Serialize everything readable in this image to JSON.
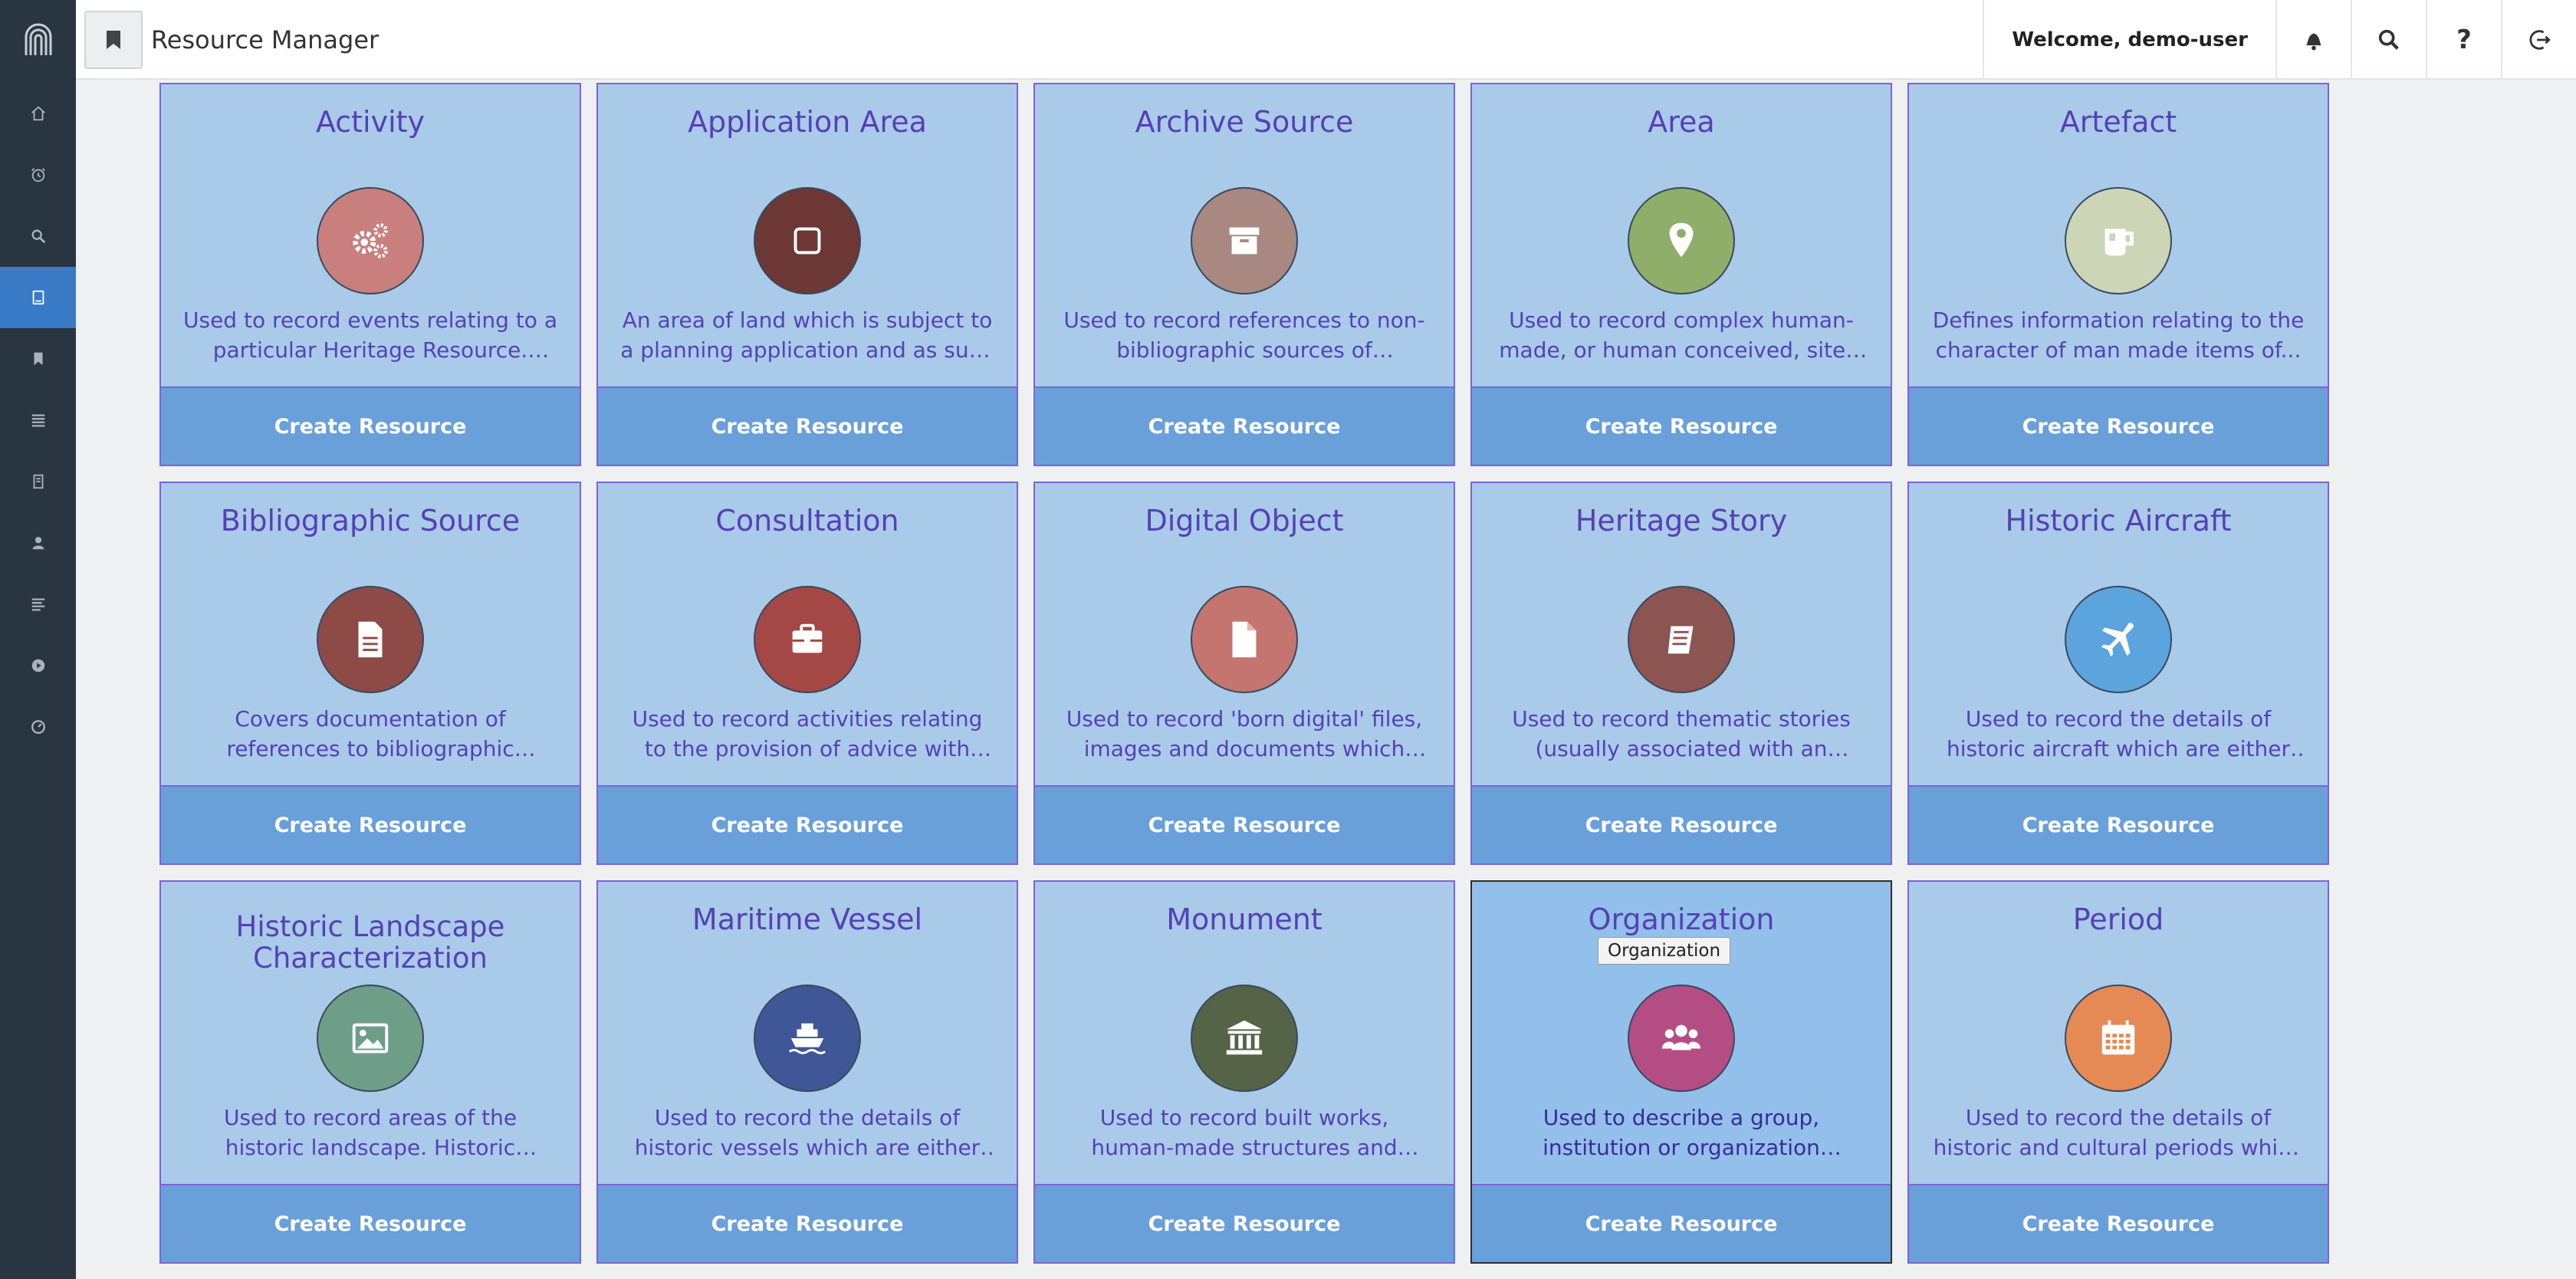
{
  "header": {
    "title": "Resource Manager",
    "welcome": "Welcome, demo-user",
    "help_label": "?"
  },
  "sidebar": {
    "items": [
      {
        "icon": "home-icon"
      },
      {
        "icon": "alarm-clock-icon"
      },
      {
        "icon": "search-icon"
      },
      {
        "icon": "resource-manager-icon",
        "active": true
      },
      {
        "icon": "bookmark-icon"
      },
      {
        "icon": "list-icon"
      },
      {
        "icon": "document-icon"
      },
      {
        "icon": "user-icon"
      },
      {
        "icon": "lines-icon"
      },
      {
        "icon": "play-circle-icon"
      },
      {
        "icon": "dashboard-icon"
      }
    ]
  },
  "tooltip": "Organization",
  "cards": [
    {
      "title": "Activity",
      "desc": "Used to record events relating to a particular Heritage Resource. Activiti...",
      "button": "Create Resource",
      "color": "#c87f7e",
      "icon": "cogs-icon"
    },
    {
      "title": "Application Area",
      "desc": "An area of land which is subject to a planning application and as such ma...",
      "button": "Create Resource",
      "color": "#6c3734",
      "icon": "square-icon"
    },
    {
      "title": "Archive Source",
      "desc": "Used to record references to non-bibliographic sources of information...",
      "button": "Create Resource",
      "color": "#a88880",
      "icon": "archive-box-icon"
    },
    {
      "title": "Area",
      "desc": "Used to record complex human-made, or human conceived, sites, areas or...",
      "button": "Create Resource",
      "color": "#8fae6a",
      "icon": "map-pin-icon"
    },
    {
      "title": "Artefact",
      "desc": "Defines information relating to the character of man made items of...",
      "button": "Create Resource",
      "color": "#ccd6b6",
      "icon": "mug-icon"
    },
    {
      "title": "Bibliographic Source",
      "desc": "Covers documentation of references to bibliographic sources of informati...",
      "button": "Create Resource",
      "color": "#8e4a47",
      "icon": "file-text-icon"
    },
    {
      "title": "Consultation",
      "desc": "Used to record activities relating to the provision of advice with regards to...",
      "button": "Create Resource",
      "color": "#a34845",
      "icon": "briefcase-icon"
    },
    {
      "title": "Digital Object",
      "desc": "Used to record 'born digital' files, images and documents which provid...",
      "button": "Create Resource",
      "color": "#c47570",
      "icon": "file-icon"
    },
    {
      "title": "Heritage Story",
      "desc": "Used to record thematic stories (usually associated with an historic...",
      "button": "Create Resource",
      "color": "#8d5551",
      "icon": "book-icon"
    },
    {
      "title": "Historic Aircraft",
      "desc": "Used to record the details of historic aircraft which are either retained as...",
      "button": "Create Resource",
      "color": "#5ba4dd",
      "icon": "plane-icon"
    },
    {
      "title": "Historic Landscape Characterization",
      "desc": "Used to record areas of the historic landscape. Historic Landscape...",
      "button": "Create Resource",
      "color": "#6e9e88",
      "icon": "image-icon"
    },
    {
      "title": "Maritime Vessel",
      "desc": "Used to record the details of historic vessels which are either retained as...",
      "button": "Create Resource",
      "color": "#3f5797",
      "icon": "ship-icon"
    },
    {
      "title": "Monument",
      "desc": "Used to record built works, human-made structures and human-modifie...",
      "button": "Create Resource",
      "color": "#556447",
      "icon": "institution-icon"
    },
    {
      "title": "Organization",
      "desc": "Used to describe a group, institution or organization associated with a herita...",
      "button": "Create Resource",
      "color": "#b34d83",
      "icon": "users-icon",
      "hover": true
    },
    {
      "title": "Period",
      "desc": "Used to record the details of historic and cultural periods which a heritage...",
      "button": "Create Resource",
      "color": "#e58955",
      "icon": "calendar-icon"
    }
  ]
}
